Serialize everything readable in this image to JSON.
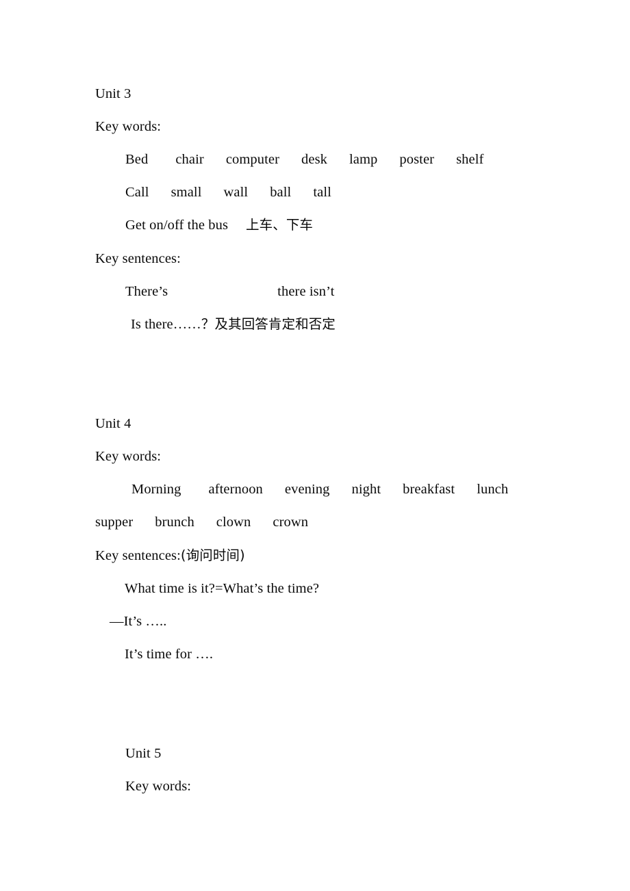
{
  "document": {
    "page_background": "#ffffff",
    "text_color": "#000000",
    "sections": [
      {
        "id": "unit-3",
        "heading": "Unit 3",
        "key_words_label": "Key words:",
        "key_words_rows": [
          [
            "Bed",
            "chair",
            "computer",
            "desk",
            "lamp",
            "poster",
            "shelf"
          ],
          [
            "Call",
            "small",
            "wall",
            "ball",
            "tall"
          ]
        ],
        "phrase_line": {
          "english": "Get on/off the bus",
          "chinese": "上车、下车"
        },
        "key_sentences_label": "Key sentences:",
        "sentences": [
          {
            "left": "There’s",
            "right": "there isn’t"
          },
          {
            "english": "Is there……",
            "chinese": "？及其回答肯定和否定"
          }
        ]
      },
      {
        "id": "unit-4",
        "heading": "Unit 4",
        "key_words_label": "Key words:",
        "key_words_rows": [
          [
            "Morning",
            "afternoon",
            "evening",
            "night",
            "breakfast",
            "lunch"
          ],
          [
            "supper",
            "brunch",
            "clown",
            "crown"
          ]
        ],
        "key_sentences_label": "Key sentences:",
        "key_sentences_note": "(询问时间)",
        "sentences": [
          "What time is it?=What’s the time?",
          "—It’s …..",
          "It’s time for …."
        ]
      },
      {
        "id": "unit-5",
        "heading": "Unit 5",
        "key_words_label": "Key words:"
      }
    ]
  }
}
